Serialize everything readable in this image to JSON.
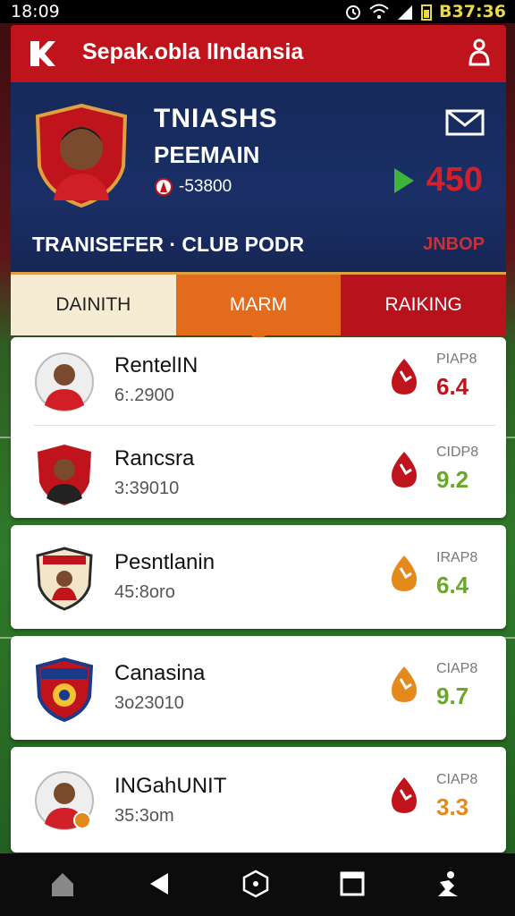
{
  "status_bar": {
    "time": "18:09",
    "battery": "B37:36"
  },
  "app_bar": {
    "title": "Sepak.obla lIndansia"
  },
  "hero": {
    "name": "TNIASHS",
    "role": "PEEMAIN",
    "value": "-53800",
    "score": "450",
    "transfer_label": "TRANISEFER · CLUB  PODR",
    "tag": "JNBOP",
    "colors": {
      "score": "#d3202b",
      "trend_up": "#3fb33c",
      "accent": "#e0a040"
    }
  },
  "tabs": [
    {
      "label": "DAINITH",
      "active": false
    },
    {
      "label": "MARM",
      "active": true
    },
    {
      "label": "RAIKING",
      "active": false
    }
  ],
  "players": [
    {
      "name": "RentelIN",
      "value": "6:.2900",
      "stat_label": "PIAP8",
      "stat_value": "6.4",
      "stat_color": "#c0141c",
      "trend_color": "#c0141c",
      "avatar": "player-avatar-icon"
    },
    {
      "name": "Rancsra",
      "value": "3:39010",
      "stat_label": "CIDP8",
      "stat_value": "9.2",
      "stat_color": "#6aa82a",
      "trend_color": "#c0141c",
      "avatar": "player-badge-icon"
    },
    {
      "name": "Pesntlanin",
      "value": "45:8oro",
      "stat_label": "IRAP8",
      "stat_value": "6.4",
      "stat_color": "#6aa82a",
      "trend_color": "#e48a1c",
      "avatar": "club-crest-icon"
    },
    {
      "name": "Canasina",
      "value": "3o23010",
      "stat_label": "CIAP8",
      "stat_value": "9.7",
      "stat_color": "#6aa82a",
      "trend_color": "#e48a1c",
      "avatar": "club-shield-icon"
    },
    {
      "name": "INGahUNIT",
      "value": "35:3om",
      "stat_label": "CIAP8",
      "stat_value": "3.3",
      "stat_color": "#e48a1c",
      "trend_color": "#c0141c",
      "avatar": "player-avatar-icon"
    }
  ],
  "nav": [
    "home-icon",
    "back-icon",
    "shield-home-icon",
    "recents-icon",
    "user-icon"
  ]
}
